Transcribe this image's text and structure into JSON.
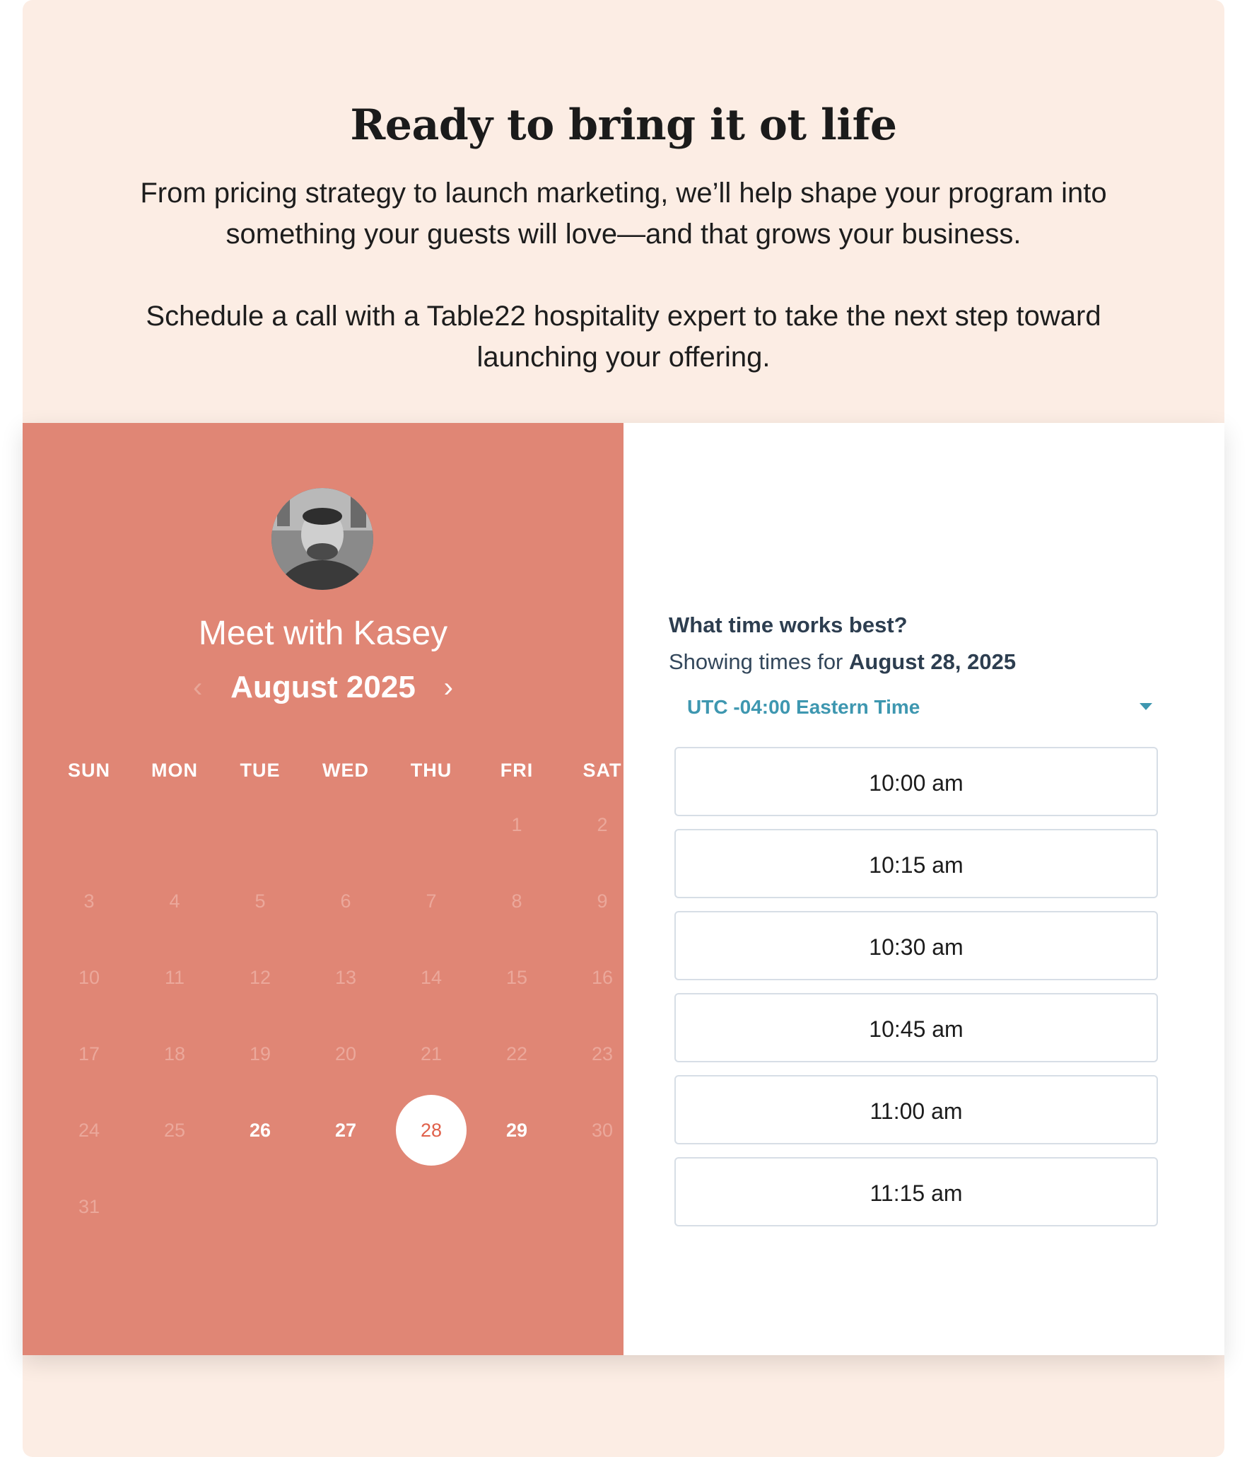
{
  "header": {
    "title": "Ready to bring it ot life",
    "intro": "From pricing strategy to launch marketing, we’ll help shape your program into something your guests will love—and that grows your business.",
    "cta": "Schedule a call with a Table22 hospitality expert to take the next step toward launching your offering."
  },
  "scheduler": {
    "meet_title": "Meet with Kasey",
    "month_label": "August 2025",
    "weekdays": [
      "SUN",
      "MON",
      "TUE",
      "WED",
      "THU",
      "FRI",
      "SAT"
    ],
    "days": [
      "1",
      "2",
      "3",
      "4",
      "5",
      "6",
      "7",
      "8",
      "9",
      "10",
      "11",
      "12",
      "13",
      "14",
      "15",
      "16",
      "17",
      "18",
      "19",
      "20",
      "21",
      "22",
      "23",
      "24",
      "25",
      "26",
      "27",
      "28",
      "29",
      "30",
      "31"
    ],
    "available_days": [
      "26",
      "27",
      "28",
      "29"
    ],
    "selected_day": "28",
    "question": "What time works best?",
    "showing_prefix": "Showing times for",
    "showing_date": "August 28, 2025",
    "timezone": "UTC -04:00 Eastern Time",
    "time_slots": [
      "10:00 am",
      "10:15 am",
      "10:30 am",
      "10:45 am",
      "11:00 am",
      "11:15 am"
    ]
  },
  "colors": {
    "page_bg": "#fcede4",
    "calendar_bg": "#e08675",
    "selected_day_text": "#e0604a",
    "timezone_accent": "#3e97b0",
    "heading_text": "#2d3e50"
  },
  "icons": {
    "prev_month": "chevron-left-icon",
    "next_month": "chevron-right-icon",
    "timezone_dropdown": "caret-down-icon"
  }
}
